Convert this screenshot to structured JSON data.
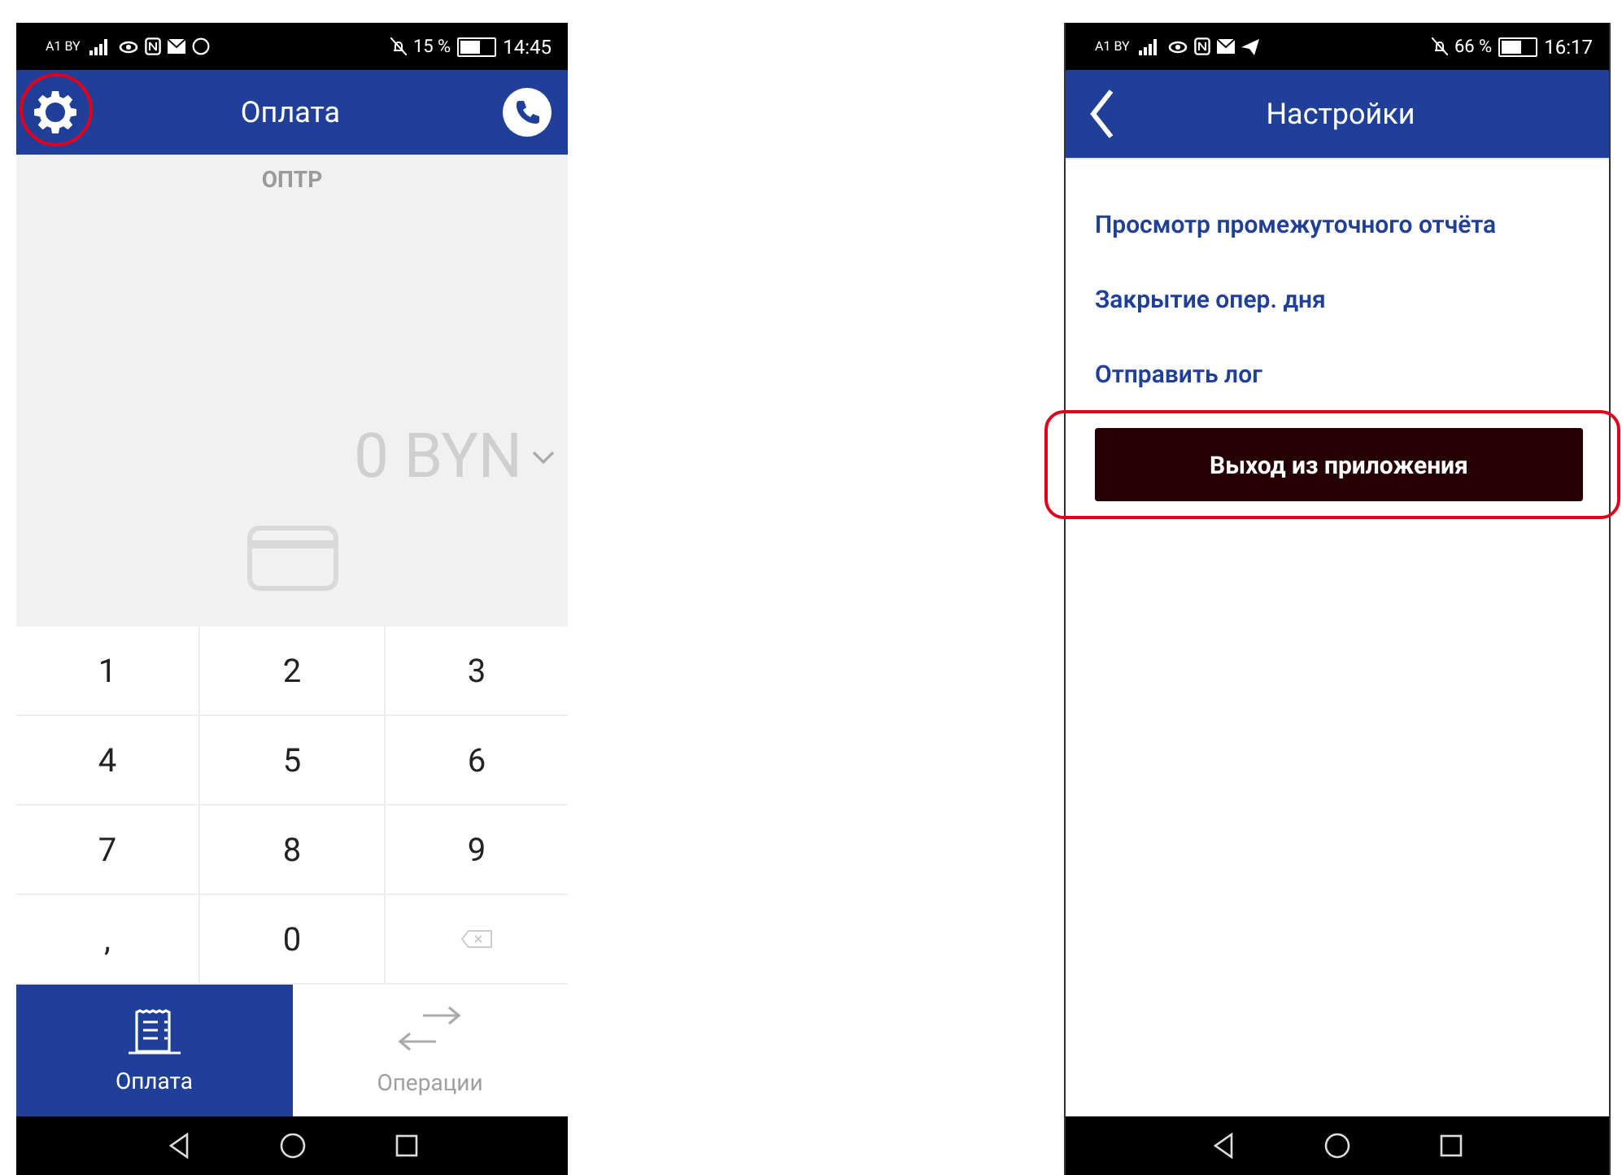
{
  "screens": [
    {
      "kind": "payment",
      "status_bar": {
        "carrier": "A1 BY",
        "battery": "15 %",
        "time": "14:45"
      },
      "header": {
        "title": "Оплата",
        "settings_highlighted": true
      },
      "merchant": "ОПТР",
      "amount": "0 BYN",
      "keypad": [
        {
          "kind": "key",
          "label": "1"
        },
        {
          "kind": "key",
          "label": "2"
        },
        {
          "kind": "key",
          "label": "3"
        },
        {
          "kind": "key",
          "label": "4"
        },
        {
          "kind": "key",
          "label": "5"
        },
        {
          "kind": "key",
          "label": "6"
        },
        {
          "kind": "key",
          "label": "7"
        },
        {
          "kind": "key",
          "label": "8"
        },
        {
          "kind": "key",
          "label": "9"
        },
        {
          "kind": "key",
          "label": ","
        },
        {
          "kind": "key",
          "label": "0"
        },
        {
          "kind": "backspace"
        }
      ],
      "tabs": [
        {
          "label": "Оплата",
          "selected": true
        },
        {
          "label": "Операции",
          "selected": false
        }
      ]
    },
    {
      "kind": "settings",
      "status_bar": {
        "carrier": "A1 BY",
        "battery": "66 %",
        "time": "16:17"
      },
      "header": {
        "title": "Настройки"
      },
      "menu": [
        {
          "label": "Просмотр промежуточного отчёта"
        },
        {
          "label": "Закрытие опер. дня"
        },
        {
          "label": "Отправить лог"
        }
      ],
      "exit_button": {
        "label": "Выход из приложения",
        "highlighted": true
      }
    }
  ]
}
